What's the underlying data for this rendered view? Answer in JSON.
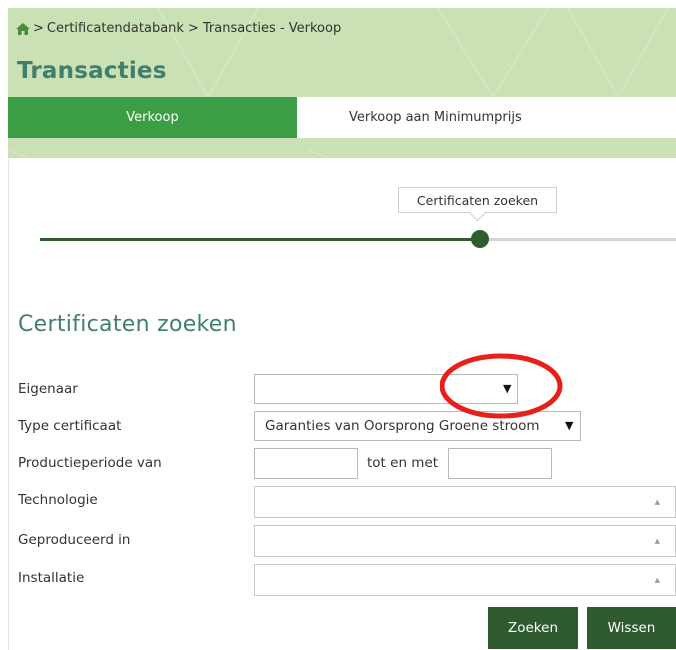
{
  "breadcrumb": {
    "home_icon": "home-icon",
    "items": [
      "Certificatendatabank",
      "Transacties - Verkoop"
    ],
    "separator": ">"
  },
  "page": {
    "title": "Transacties"
  },
  "tabs": [
    {
      "label": "Verkoop",
      "active": true
    },
    {
      "label": "Verkoop aan Minimumprijs",
      "active": false
    }
  ],
  "stepper": {
    "current_step_label": "Certificaten zoeken"
  },
  "form": {
    "title": "Certificaten zoeken",
    "eigenaar": {
      "label": "Eigenaar",
      "value": ""
    },
    "type_certificaat": {
      "label": "Type certificaat",
      "value": "Garanties van Oorsprong Groene stroom"
    },
    "productieperiode": {
      "label": "Productieperiode van",
      "from_value": "",
      "to_label": "tot en met",
      "to_value": ""
    },
    "technologie": {
      "label": "Technologie"
    },
    "geproduceerd_in": {
      "label": "Geproduceerd in"
    },
    "installatie": {
      "label": "Installatie"
    },
    "buttons": {
      "search": "Zoeken",
      "clear": "Wissen"
    }
  },
  "colors": {
    "header_bg": "#c9e1b4",
    "title_green": "#3f7f6b",
    "tab_active": "#3c9e44",
    "dark_green": "#2f5a30",
    "annotation_red": "#e8201c"
  }
}
